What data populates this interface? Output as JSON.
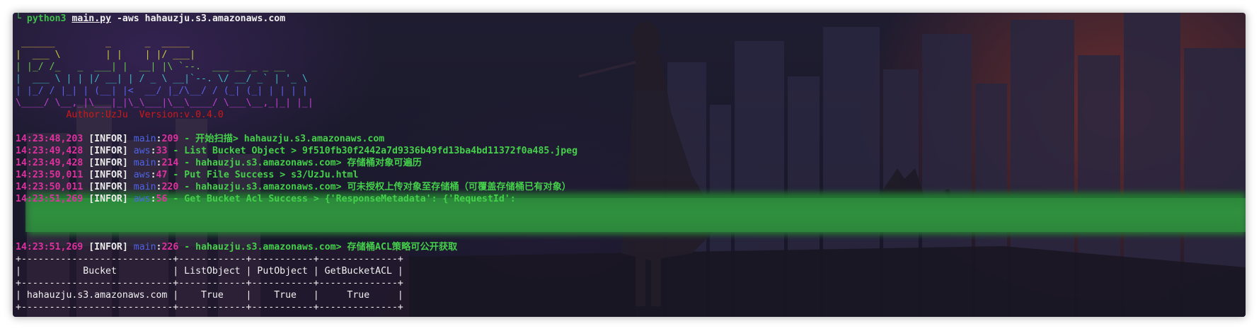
{
  "command": {
    "prompt_glyph": "└",
    "program": "python3",
    "script": "main.py",
    "args": "-aws hahauzju.s3.amazonaws.com"
  },
  "banner": {
    "lines": [
      " ______         _      _  _____",
      "|  ___ \\        | |    | |/ ___|",
      "| |_/ /_   _  ___| |  __| |\\ `--.  ___ __ _ _ __",
      "|  ___ \\ | | |/ __| | / _ \\ __|`--. \\/ __/ _` | '_ \\",
      "| |_/ / |_| | (__| |<  __/ |_/\\__/ / (_| (_| | | | |",
      "\\____/ \\__,_|\\___|_|\\_\\___|\\__\\____/ \\___\\__,_|_| |_|"
    ],
    "colors": [
      "#e3b23c",
      "#c9c93a",
      "#67c24a",
      "#3fb7c8",
      "#5b63e8",
      "#c03fd0"
    ],
    "author_line": "         Author:UzJu  Version:v.0.4.0"
  },
  "logs": [
    {
      "time": "14:23:48,203",
      "level": "[INFOR]",
      "module": "main",
      "line": "209",
      "message": " - 开始扫描> hahauzju.s3.amazonaws.com"
    },
    {
      "time": "14:23:49,428",
      "level": "[INFOR]",
      "module": "aws",
      "line": "33",
      "message": " - List Bucket Object > 9f510fb30f2442a7d9336b49fd13ba4bd11372f0a485.jpeg"
    },
    {
      "time": "14:23:49,428",
      "level": "[INFOR]",
      "module": "main",
      "line": "214",
      "message": " - hahauzju.s3.amazonaws.com> 存储桶对象可遍历"
    },
    {
      "time": "14:23:50,011",
      "level": "[INFOR]",
      "module": "aws",
      "line": "47",
      "message": " - Put File Success > s3/UzJu.html"
    },
    {
      "time": "14:23:50,011",
      "level": "[INFOR]",
      "module": "main",
      "line": "220",
      "message": " - hahauzju.s3.amazonaws.com> 可未授权上传对象至存储桶（可覆盖存储桶已有对象）"
    },
    {
      "time": "14:23:51,269",
      "level": "[INFOR]",
      "module": "aws",
      "line": "56",
      "message": " - Get Bucket Acl Success > {'ResponseMetadata': {'RequestId':"
    }
  ],
  "final_log": {
    "time": "14:23:51,269",
    "level": "[INFOR]",
    "module": "main",
    "line": "226",
    "message": " - hahauzju.s3.amazonaws.com> 存储桶ACL策略可公开获取"
  },
  "table": {
    "border": "+---------------------------+------------+-----------+--------------+",
    "header": "|           Bucket          | ListObject | PutObject | GetBucketACL |",
    "row": "| hahauzju.s3.amazonaws.com |    True    |    True   |     True     |"
  }
}
